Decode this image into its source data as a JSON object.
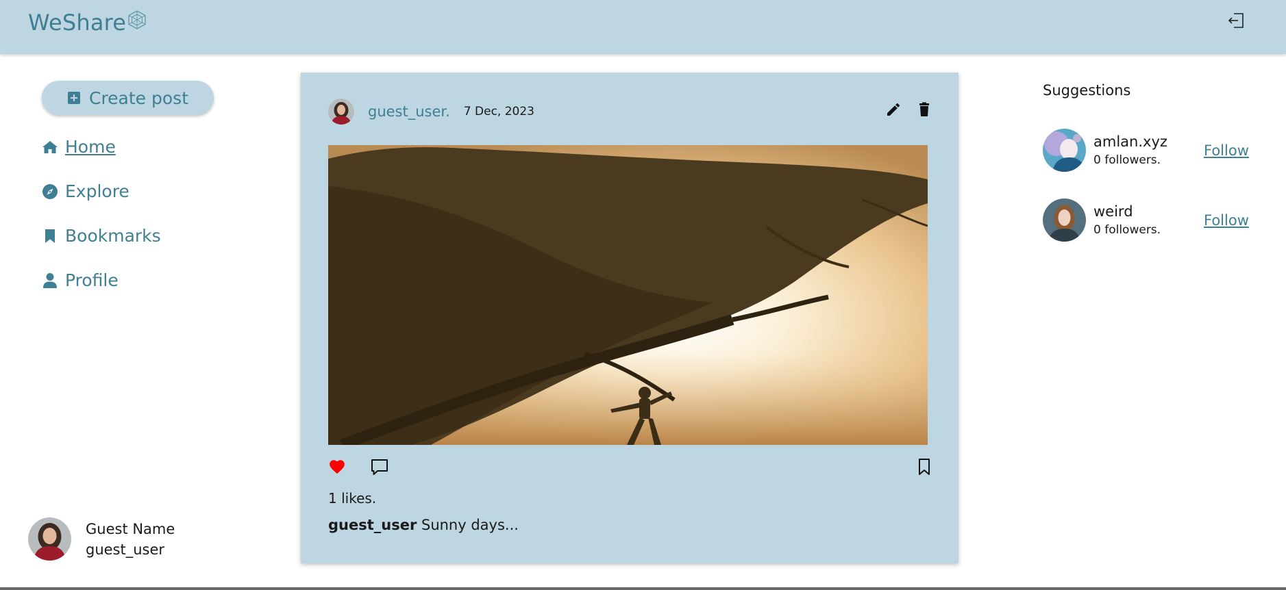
{
  "header": {
    "logo_text": "WeShare",
    "logo_icon": "hexagon-net-icon",
    "logout_icon": "logout-icon"
  },
  "sidebar": {
    "create_post_label": "Create post",
    "create_post_icon": "plus-square-icon",
    "items": [
      {
        "label": "Home",
        "icon": "home-icon",
        "active": true
      },
      {
        "label": "Explore",
        "icon": "compass-icon",
        "active": false
      },
      {
        "label": "Bookmarks",
        "icon": "bookmark-icon",
        "active": false
      },
      {
        "label": "Profile",
        "icon": "user-icon",
        "active": false
      }
    ]
  },
  "current_user": {
    "display_name": "Guest Name",
    "username": "guest_user"
  },
  "post": {
    "author": "guest_user.",
    "date": "7 Dec, 2023",
    "likes_text": "1 likes.",
    "caption_user": "guest_user",
    "caption_text": " Sunny days...",
    "liked": true
  },
  "suggestions": {
    "title": "Suggestions",
    "follow_label": "Follow",
    "users": [
      {
        "name": "amlan.xyz",
        "followers": "0 followers."
      },
      {
        "name": "weird",
        "followers": "0 followers."
      }
    ]
  },
  "colors": {
    "accent": "#3f7f93",
    "panel": "#bdd6e1",
    "like": "#ff0000"
  }
}
